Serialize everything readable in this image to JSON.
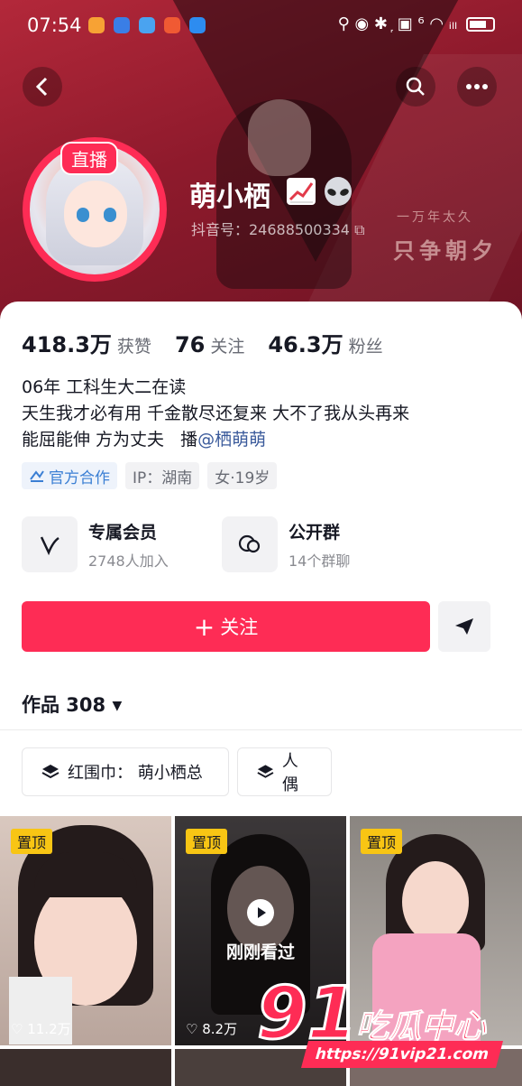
{
  "status_bar": {
    "time": "07:54",
    "indicators": "⚲ ◉ ✱ ᷊ ▣ ⁶ ◠ ᵢₗₗ"
  },
  "banner": {
    "slogan_small": "一万年太久",
    "slogan_large": "只争朝夕"
  },
  "profile": {
    "live_badge": "直播",
    "nickname": "萌小栖",
    "douyin_id": "抖音号：24688500334 ⧉",
    "stats": [
      {
        "value": "418.3万",
        "label": "获赞"
      },
      {
        "value": "76",
        "label": "关注"
      },
      {
        "value": "46.3万",
        "label": "粉丝"
      }
    ],
    "bio_lines": [
      "06年  工科生大二在读",
      "天生我才必有用 千金散尽还复来 大不了我从头再来",
      "能屈能伸 方为丈夫   播"
    ],
    "mention": "@栖萌萌",
    "tags": [
      "官方合作",
      "IP：湖南",
      "女·19岁"
    ]
  },
  "features": [
    {
      "title": "专属会员",
      "subtitle": "2748人加入",
      "icon": "v-icon"
    },
    {
      "title": "公开群",
      "subtitle": "14个群聊",
      "icon": "chat-bubbles-icon"
    }
  ],
  "actions": {
    "follow_label": "关注",
    "follow_prefix": "+"
  },
  "works": {
    "label": "作品 308",
    "collections": [
      "红围巾： 萌小栖总",
      "人偶"
    ],
    "videos": [
      {
        "pinned": "置顶",
        "likes": "♡ 11.2万",
        "overlay": ""
      },
      {
        "pinned": "置顶",
        "likes": "♡ 8.2万",
        "overlay": "刚刚看过"
      },
      {
        "pinned": "置顶",
        "likes": "",
        "overlay": ""
      }
    ]
  },
  "watermark": {
    "number": "91",
    "name": "吃瓜中心",
    "url": "https://91vip21.com"
  },
  "colors": {
    "accent": "#fe2c55",
    "pin": "#f8c514",
    "banner": "#a32334"
  }
}
